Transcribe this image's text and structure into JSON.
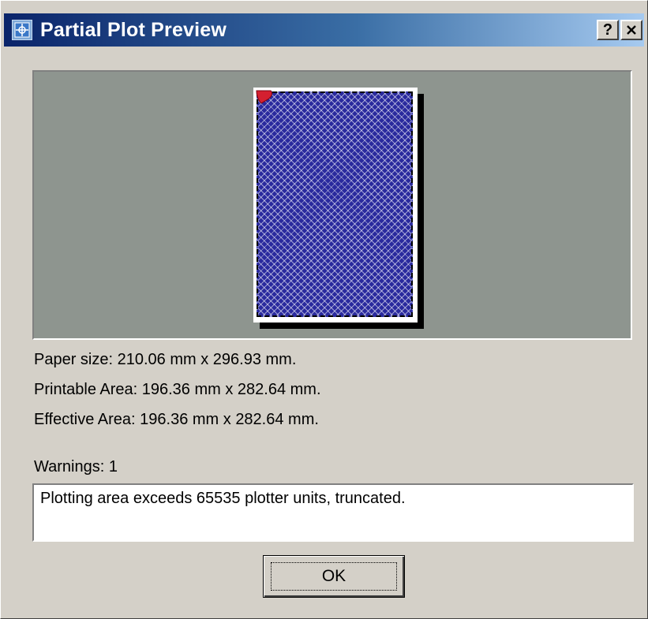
{
  "window": {
    "title": "Partial Plot Preview",
    "icon": "plot-preview-app-icon",
    "help_label": "?",
    "close_label": "✕"
  },
  "preview": {
    "paper_color": "#ffffff",
    "background_color": "#8e958f",
    "plot_fill_color": "#2a2a9e",
    "marker_color": "#d42030"
  },
  "info": {
    "paper_size": "Paper size:  210.06 mm x 296.93 mm.",
    "printable_area": "Printable Area:  196.36 mm x 282.64 mm.",
    "effective_area": "Effective Area:  196.36 mm x 282.64 mm."
  },
  "warnings": {
    "label": "Warnings:  1",
    "messages": [
      "Plotting area exceeds 65535 plotter units, truncated."
    ]
  },
  "buttons": {
    "ok_label": "OK"
  }
}
